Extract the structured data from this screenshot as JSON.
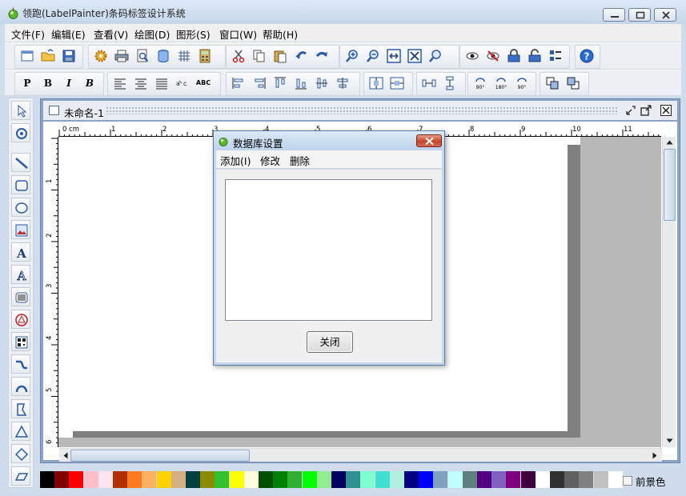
{
  "app": {
    "title": "领跑(LabelPainter)条码标签设计系统"
  },
  "menubar": [
    {
      "key": "file",
      "label": "文件(F)"
    },
    {
      "key": "edit",
      "label": "编辑(E)"
    },
    {
      "key": "view",
      "label": "查看(V)"
    },
    {
      "key": "draw",
      "label": "绘图(D)"
    },
    {
      "key": "shape",
      "label": "图形(S)"
    },
    {
      "key": "window",
      "label": "窗口(W)"
    },
    {
      "key": "help",
      "label": "帮助(H)"
    }
  ],
  "format_toolbar": {
    "bold_p": "P",
    "bold_b": "B",
    "italic_i": "I",
    "bold_italic_b": "B",
    "abc": "ABC",
    "rot90": "90°",
    "rot180": "180°",
    "rot90b": "90°"
  },
  "document": {
    "title": "未命名-1"
  },
  "ruler": {
    "top_labels": [
      "0 cm",
      "1",
      "2",
      "3",
      "4",
      "5",
      "6",
      "7",
      "8",
      "9",
      "10",
      "11"
    ],
    "left_labels": [
      "1",
      "2",
      "3",
      "4",
      "5",
      "6"
    ]
  },
  "dialog": {
    "title": "数据库设置",
    "menu": [
      "添加(I)",
      "修改",
      "删除"
    ],
    "close_button": "关闭"
  },
  "palette": {
    "colors": [
      "#000000",
      "#800000",
      "#ff0000",
      "#ffc0cb",
      "#ffe4f0",
      "#b03000",
      "#ff7a20",
      "#ffb060",
      "#ffd000",
      "#d4b080",
      "#004040",
      "#8b8b00",
      "#30c030",
      "#ffff00",
      "#ffffe0",
      "#005000",
      "#008000",
      "#30b030",
      "#00ff00",
      "#90ee90",
      "#000060",
      "#309090",
      "#80ffd0",
      "#40e0d0",
      "#b0f0e0",
      "#000080",
      "#0000ff",
      "#80a0c0",
      "#c0ffff",
      "#608080",
      "#500080",
      "#8060c0",
      "#800080",
      "#400040",
      "#ffffff",
      "#303030",
      "#606060",
      "#808080",
      "#c0c0c0",
      "#ffffff"
    ],
    "foreground_label": "前景色"
  }
}
